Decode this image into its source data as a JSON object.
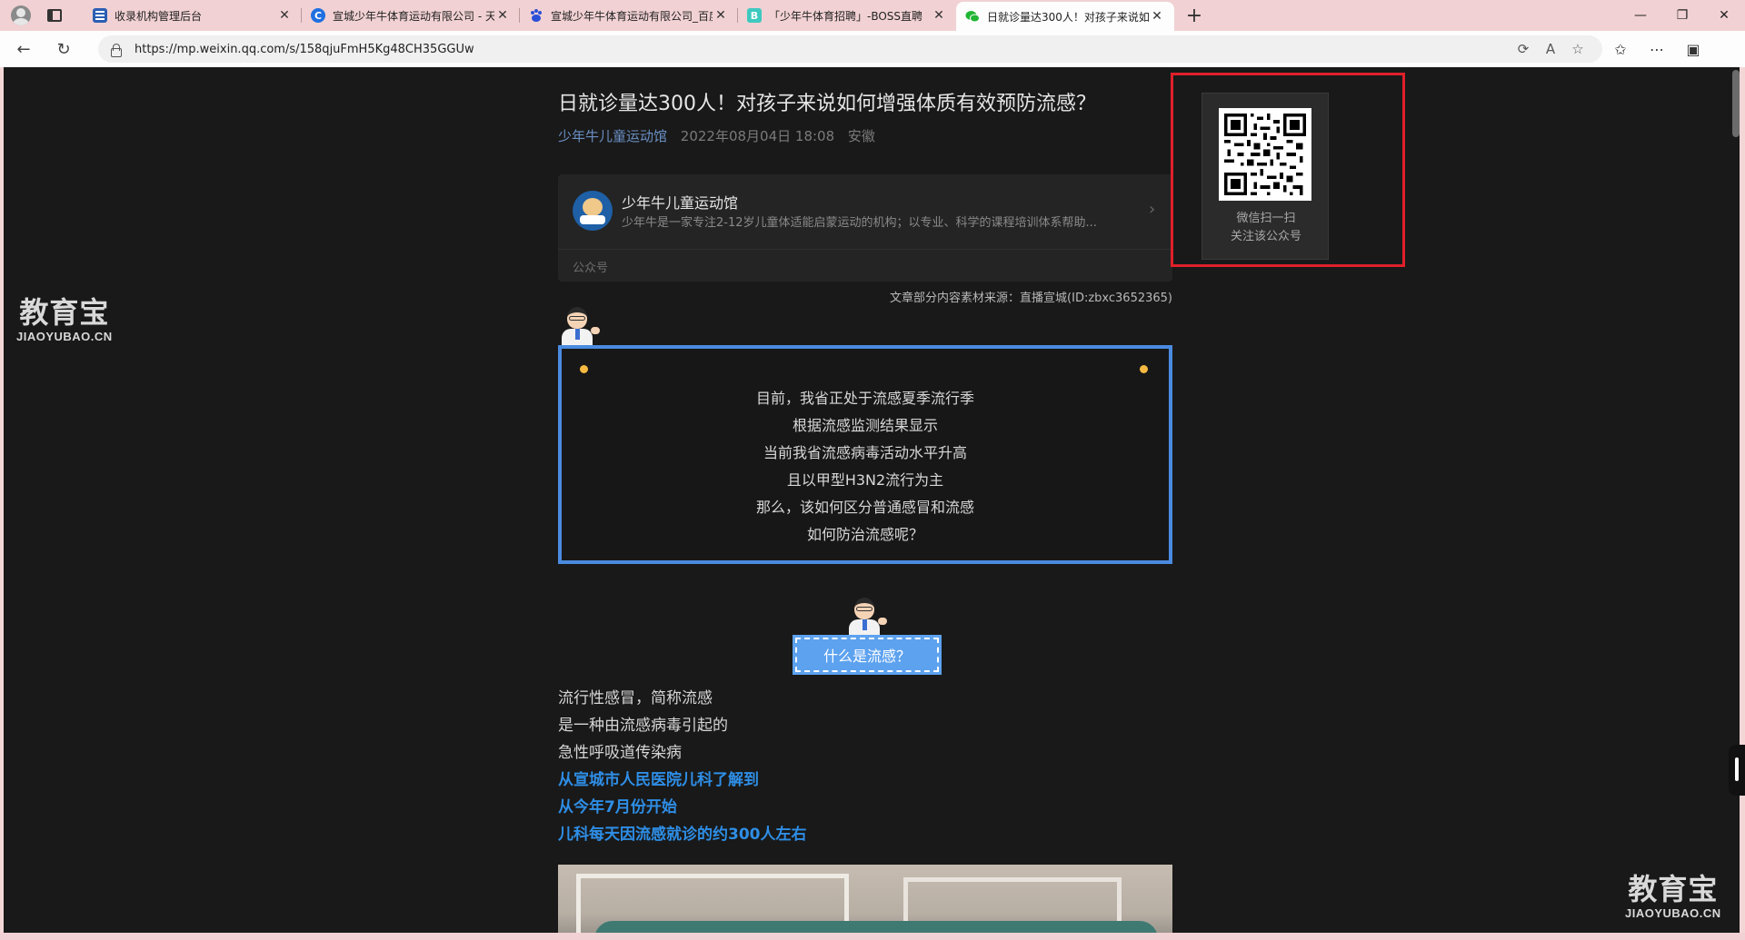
{
  "browser": {
    "tabs": [
      {
        "title": "收录机构管理后台",
        "favicon": "admin-favicon",
        "color": "#2b5fb3",
        "glyph": "",
        "active": false
      },
      {
        "title": "宣城少年牛体育运动有限公司 - 天",
        "favicon": "tianyancha-favicon",
        "color": "#1f6fe0",
        "glyph": "C",
        "active": false
      },
      {
        "title": "宣城少年牛体育运动有限公司_百度",
        "favicon": "baidu-favicon",
        "color": "#2a50d8",
        "glyph": "",
        "active": false
      },
      {
        "title": "「少年牛体育招聘」-BOSS直聘",
        "favicon": "boss-favicon",
        "color": "#3ec9c0",
        "glyph": "B",
        "active": false
      },
      {
        "title": "日就诊量达300人！对孩子来说如",
        "favicon": "wechat-favicon",
        "color": "#21b533",
        "glyph": "",
        "active": true
      }
    ],
    "new_tab": "+",
    "url": "https://mp.weixin.qq.com/s/158qjuFmH5Kg48CH35GGUw"
  },
  "article": {
    "title": "日就诊量达300人！对孩子来说如何增强体质有效预防流感？",
    "author": "少年牛儿童运动馆",
    "date": "2022年08月04日 18:08",
    "location": "安徽",
    "profile": {
      "name": "少年牛儿童运动馆",
      "description": "少年牛是一家专注2-12岁儿童体适能启蒙运动的机构；以专业、科学的课程培训体系帮助...",
      "type": "公众号"
    },
    "source_note": "文章部分内容素材来源：直播宣城(ID:zbxc3652365)",
    "quote_lines": [
      "目前，我省正处于流感夏季流行季",
      "根据流感监测结果显示",
      "当前我省流感病毒活动水平升高",
      "且以甲型H3N2流行为主",
      "那么，该如何区分普通感冒和流感",
      "如何防治流感呢？"
    ],
    "section_heading": "什么是流感？",
    "body_lines": [
      "流行性感冒，简称流感",
      "是一种由流感病毒引起的",
      "急性呼吸道传染病"
    ],
    "highlight_lines": [
      "从宣城市人民医院儿科了解到",
      "从今年7月份开始",
      "儿科每天因流感就诊的约300人左右"
    ]
  },
  "qr_popup": {
    "line1": "微信扫一扫",
    "line2": "关注该公众号",
    "highlight_color": "#e0202a"
  },
  "watermark": {
    "cn": "教育宝",
    "en": "JIAOYUBAO.CN"
  }
}
